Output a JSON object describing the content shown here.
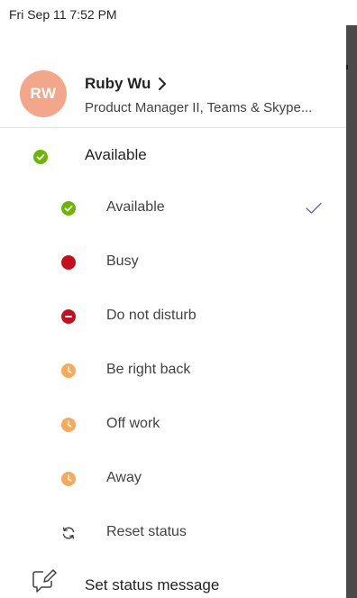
{
  "status_bar": {
    "time": "Fri Sep 11  7:52 PM"
  },
  "profile": {
    "initials": "RW",
    "name": "Ruby Wu",
    "title": "Product Manager II, Teams & Skype..."
  },
  "current_status": {
    "label": "Available",
    "icon": "available-icon"
  },
  "status_options": [
    {
      "label": "Available",
      "icon": "available-icon",
      "selected": true
    },
    {
      "label": "Busy",
      "icon": "busy-icon",
      "selected": false
    },
    {
      "label": "Do not disturb",
      "icon": "do-not-disturb-icon",
      "selected": false
    },
    {
      "label": "Be right back",
      "icon": "clock-icon",
      "selected": false
    },
    {
      "label": "Off work",
      "icon": "clock-icon",
      "selected": false
    },
    {
      "label": "Away",
      "icon": "clock-icon",
      "selected": false
    },
    {
      "label": "Reset status",
      "icon": "reset-icon",
      "selected": false
    }
  ],
  "set_status_message": {
    "label": "Set status message",
    "icon": "edit-icon"
  },
  "colors": {
    "available": "#6bb700",
    "busy": "#c4314b",
    "dnd": "#c50f1f",
    "away": "#f8a95a",
    "avatar": "#f2a78b",
    "check": "#6264a7"
  }
}
